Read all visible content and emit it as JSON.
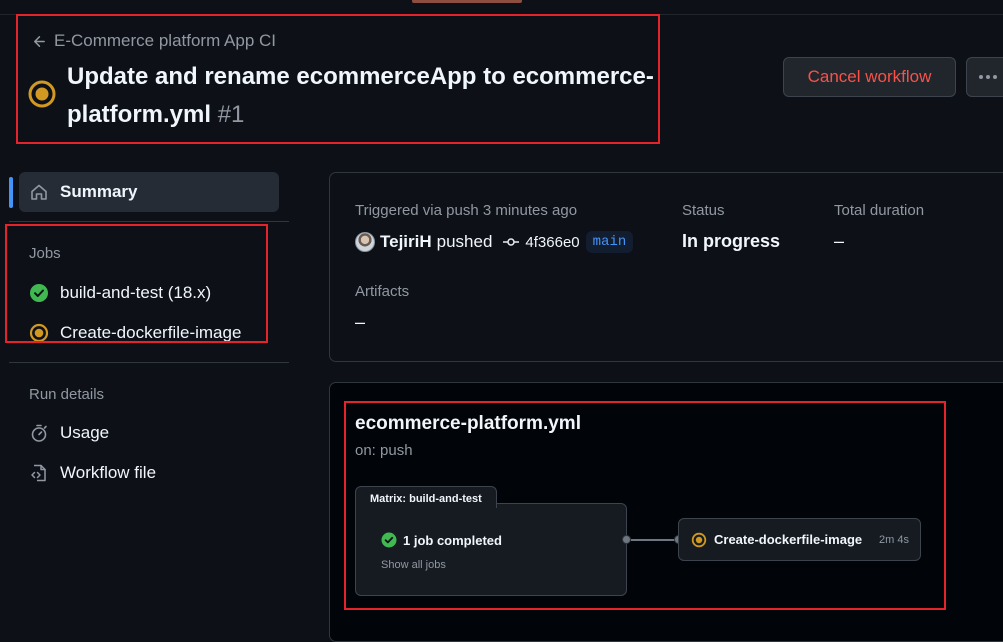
{
  "header": {
    "back_label": "E-Commerce platform App CI",
    "title": "Update and rename ecommerceApp to ecommerce-platform.yml",
    "run_number": "#1",
    "status_icon": "in-progress-icon",
    "cancel_label": "Cancel workflow",
    "more_icon": "kebab-horizontal-icon"
  },
  "sidebar": {
    "summary_label": "Summary",
    "jobs_heading": "Jobs",
    "jobs": [
      {
        "label": "build-and-test (18.x)",
        "status": "success"
      },
      {
        "label": "Create-dockerfile-image",
        "status": "in_progress"
      }
    ],
    "run_details_heading": "Run details",
    "run_details": [
      {
        "label": "Usage",
        "icon": "stopwatch-icon"
      },
      {
        "label": "Workflow file",
        "icon": "file-code-icon"
      }
    ]
  },
  "summary": {
    "trigger_label": "Triggered via push 3 minutes ago",
    "actor": "TejiriH",
    "action": "pushed",
    "commit_sha": "4f366e0",
    "branch": "main",
    "status_label": "Status",
    "status_value": "In progress",
    "duration_label": "Total duration",
    "duration_value": "–",
    "artifacts_label": "Artifacts",
    "artifacts_value": "–"
  },
  "graph": {
    "workflow_file": "ecommerce-platform.yml",
    "trigger": "on: push",
    "matrix_label": "Matrix: build-and-test",
    "matrix_status": "1 job completed",
    "show_all": "Show all jobs",
    "job_name": "Create-dockerfile-image",
    "job_time": "2m 4s"
  },
  "colors": {
    "background": "#0d1117",
    "accent_blue": "#4493f8",
    "success": "#3fb950",
    "in_progress": "#d29922",
    "danger": "#f85149",
    "annotation": "#e5232b"
  }
}
